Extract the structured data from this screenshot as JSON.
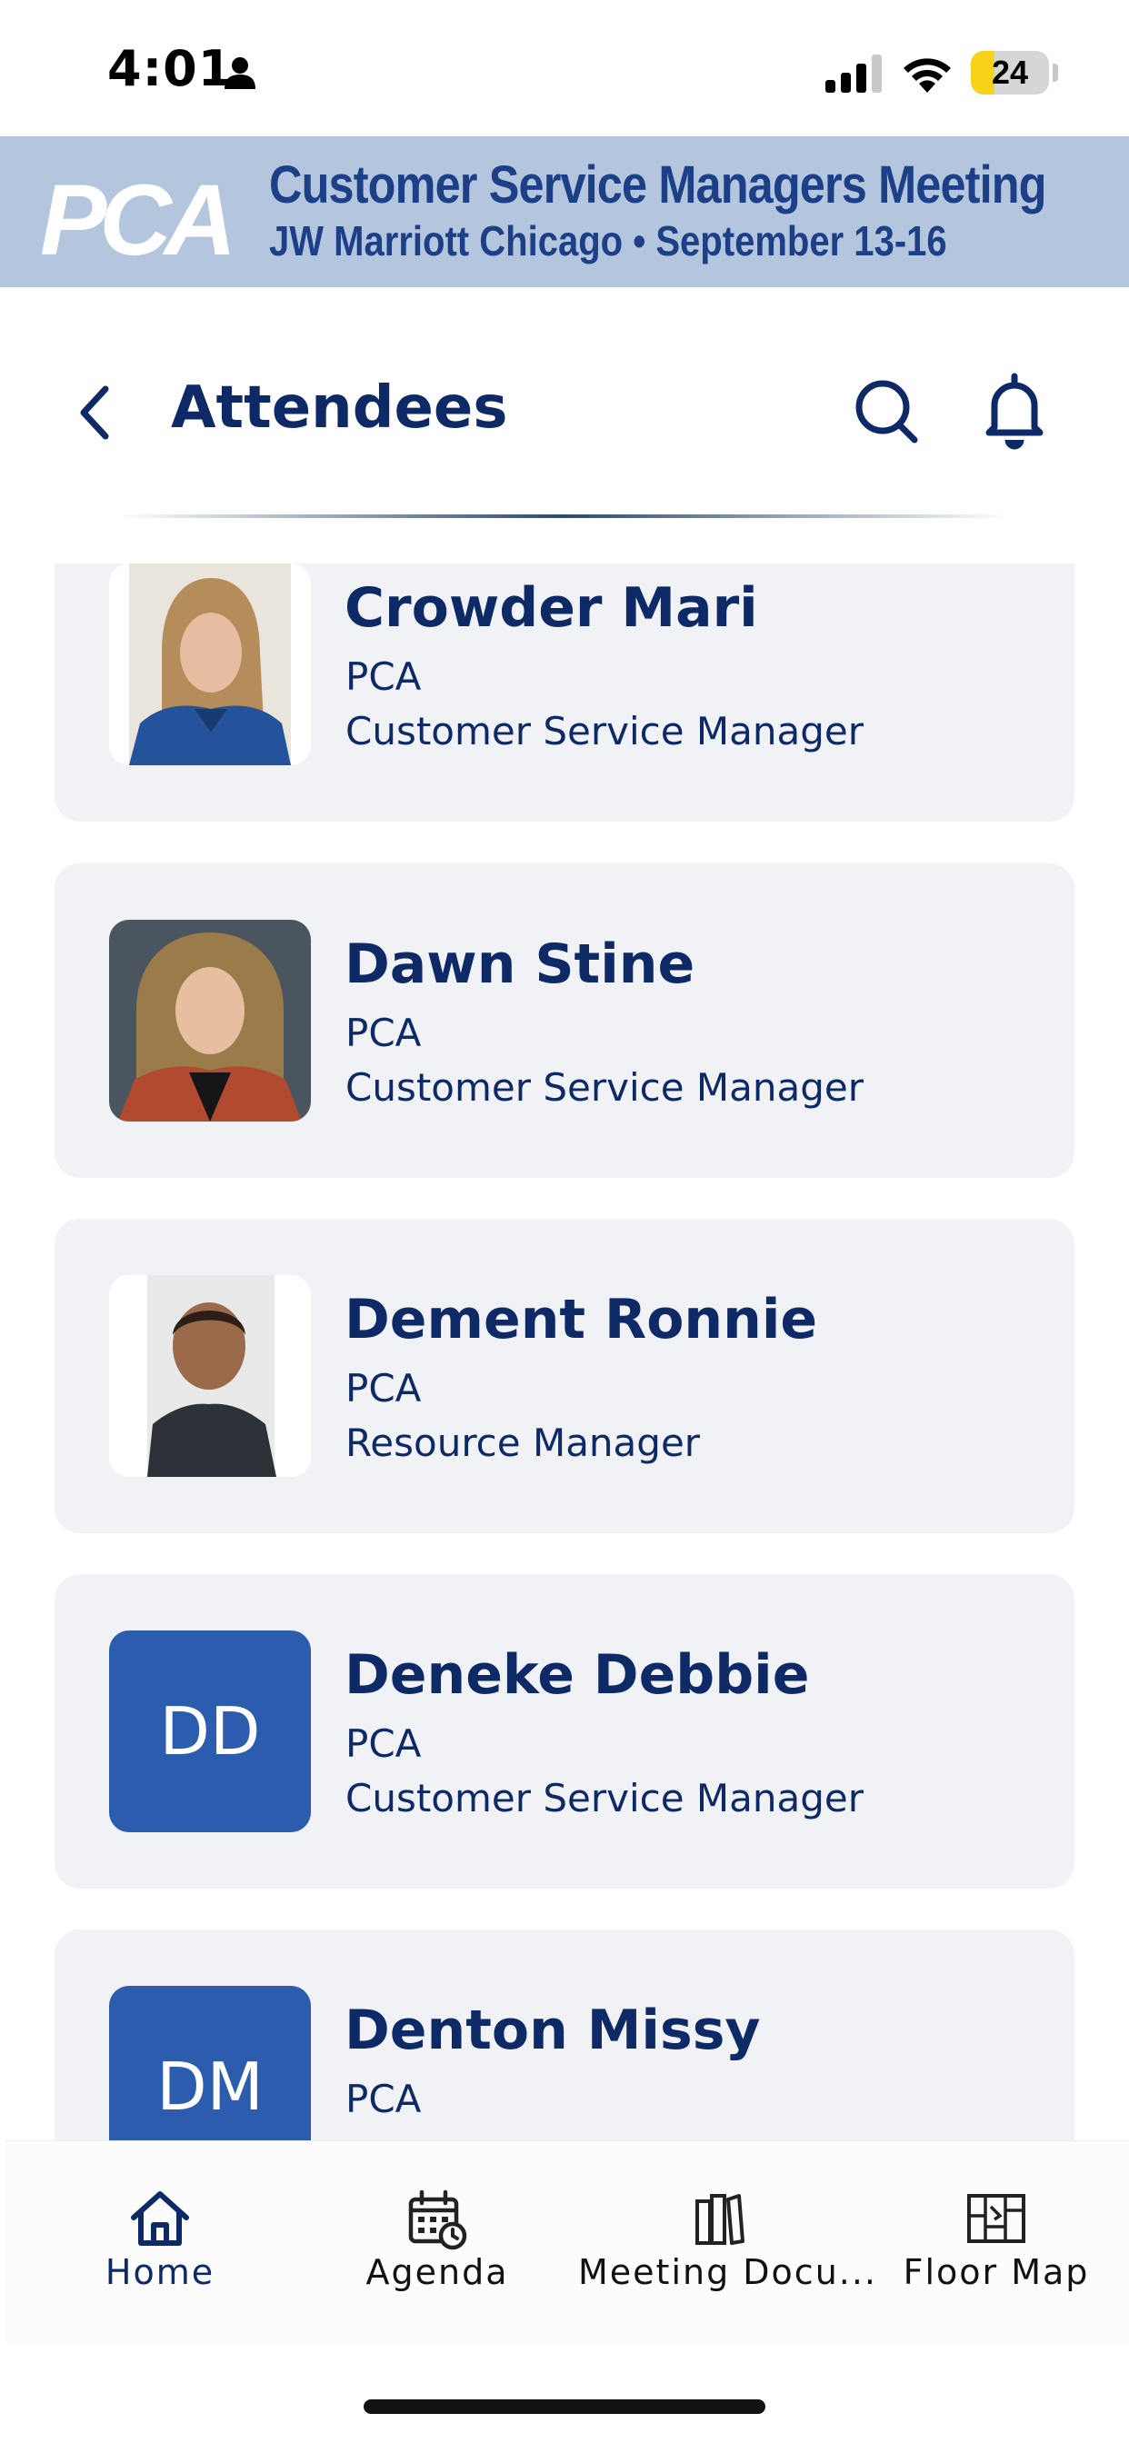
{
  "status_bar": {
    "time": "4:01",
    "battery": "24"
  },
  "banner": {
    "logo": "PCA",
    "title": "Customer Service Managers Meeting",
    "subtitle": "JW Marriott Chicago • September 13-16"
  },
  "header": {
    "title": "Attendees"
  },
  "attendees": [
    {
      "name": "Crowder Mari",
      "org": "PCA",
      "role": "Customer Service Manager",
      "initials": ""
    },
    {
      "name": "Dawn Stine",
      "org": "PCA",
      "role": "Customer Service Manager",
      "initials": ""
    },
    {
      "name": "Dement Ronnie",
      "org": "PCA",
      "role": "Resource Manager",
      "initials": ""
    },
    {
      "name": "Deneke Debbie",
      "org": "PCA",
      "role": "Customer Service Manager",
      "initials": "DD"
    },
    {
      "name": "Denton Missy",
      "org": "PCA",
      "role": "",
      "initials": "DM"
    }
  ],
  "nav": {
    "items": [
      {
        "label": "Home",
        "icon": "home-icon",
        "active": true
      },
      {
        "label": "Agenda",
        "icon": "calendar-icon",
        "active": false
      },
      {
        "label": "Meeting Docu...",
        "icon": "documents-icon",
        "active": false
      },
      {
        "label": "Floor Map",
        "icon": "map-icon",
        "active": false
      }
    ]
  },
  "colors": {
    "primary": "#0e2a66",
    "banner_bg": "#b4c6dd",
    "card_bg": "#f1f2f6",
    "avatar_initials_bg": "#2b5cad"
  }
}
